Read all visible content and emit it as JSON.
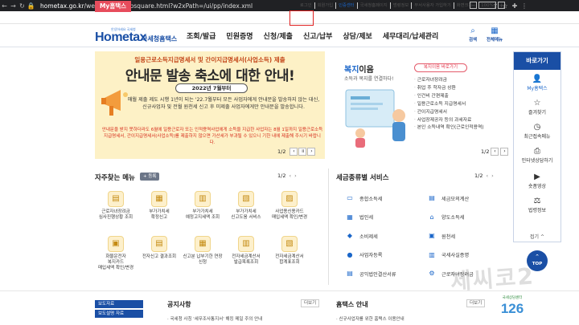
{
  "browser": {
    "url_host": "hometax.go.kr",
    "url_path": "/websquare/websquare.html?w2xPath=/ui/pp/index.xml"
  },
  "util_bar": {
    "my_hometax": "My홈택스",
    "links": [
      {
        "label": "로그인",
        "accent": false
      },
      {
        "label": "회원가입",
        "accent": false
      },
      {
        "label": "인증센터",
        "accent": true
      },
      {
        "label": "국세청홈페이지",
        "accent": false
      },
      {
        "label": "범령정보",
        "accent": false
      },
      {
        "label": "부서사용자 가입하기",
        "accent": false
      },
      {
        "label": "화면크기",
        "accent": false
      }
    ],
    "zoom_value": "100%"
  },
  "header": {
    "logo_main": "Hometax",
    "logo_sub": "국세청홈택스",
    "logo_tiny": "안녕하세요 국세청",
    "nav": [
      "조회/발급",
      "민원증명",
      "신청/제출",
      "신고/납부",
      "상담/제보",
      "세무대리/납세관리"
    ],
    "search_label": "검색",
    "allmenu_label": "전체메뉴"
  },
  "banner": {
    "title_small": "일용근로소득지급명세서 및 간이지급명세서(사업소득) 제출",
    "title_big": "안내문 발송 축소에 대한 안내!",
    "date": "2022년 7월부터",
    "body": "매월 제출 제도 시행 1년이 되는 '22.7월부터 모든 사업자에게 안내문을 발송하지 않는 대신, 신규사업자 및 전월 원천세 신고 후 미제출 사업자에게만 안내문을 발송합니다.",
    "notice": "안내문을 받지 못하더라도 6월에 일용근로자 또는 인적용역사업에게 소득을 지급한 사업자는 8월 1일까지 일용근로소득지급명세서, 간이지급명세서(사업소득)를 제출하지 않으면 가산세가 부과될 수 있으니 기한 내에 제출해 주시기 바랍니다.",
    "page": "1/2"
  },
  "welfare": {
    "title_a": "복지",
    "title_b": "이음",
    "desc": "소득과 복지를 연결하다!",
    "button": "복지이음 바로가기",
    "items": [
      "근로자녀장려금",
      "취업 후 학자금 상환",
      "인건비 간편제출",
      "일용근로소득 지급명세서",
      "간이지급명세서",
      "사업장제공자 등의 과세자료",
      "본인 소득내역 확인(근로인적용역)"
    ],
    "page": "1/2"
  },
  "sidebar": {
    "title": "바로가기",
    "items": [
      {
        "icon": "user-icon",
        "glyph": "👤",
        "label": "My홈택스"
      },
      {
        "icon": "star-icon",
        "glyph": "☆",
        "label": "즐겨찾기"
      },
      {
        "icon": "clock-icon",
        "glyph": "◷",
        "label": "최근접속메뉴"
      },
      {
        "icon": "printer-icon",
        "glyph": "⎙",
        "label": "인터넷상담하기"
      },
      {
        "icon": "video-icon",
        "glyph": "▶",
        "label": "숏폼영상"
      },
      {
        "icon": "scale-icon",
        "glyph": "⚖",
        "label": "법령정보"
      }
    ],
    "fold": "접기 ^",
    "top": "TOP"
  },
  "faq": {
    "title": "자주찾는 메뉴",
    "badge": "+ 등록",
    "page": "1/2",
    "items": [
      {
        "glyph": "▤",
        "label": "근로자녀장려금\n심사진행상황 조회"
      },
      {
        "glyph": "▦",
        "label": "부가가치세\n확정신고"
      },
      {
        "glyph": "▥",
        "label": "부가가치세\n예정고지세액 조회"
      },
      {
        "glyph": "▧",
        "label": "부가가치세\n신고도움 서비스"
      },
      {
        "glyph": "▨",
        "label": "사업용신용카드\n매입세액 확인/변경"
      },
      {
        "glyph": "▣",
        "label": "화물운전자\n복지카드\n매입세액 확인/변경"
      },
      {
        "glyph": "▤",
        "label": "전자신고 결과조회"
      },
      {
        "glyph": "▦",
        "label": "신고분 납부기한 연장신청"
      },
      {
        "glyph": "▥",
        "label": "전자세금계산서\n발급목록조회"
      },
      {
        "glyph": "▧",
        "label": "전자세금계산서\n합계표조회"
      }
    ]
  },
  "tax": {
    "title": "세금종류별 서비스",
    "page": "1/2",
    "items": [
      {
        "glyph": "▭",
        "label": "종합소득세"
      },
      {
        "glyph": "▤",
        "label": "세금모의계산"
      },
      {
        "glyph": "▦",
        "label": "법인세"
      },
      {
        "glyph": "⌂",
        "label": "양도소득세"
      },
      {
        "glyph": "◆",
        "label": "소비제세"
      },
      {
        "glyph": "▣",
        "label": "원천세"
      },
      {
        "glyph": "●",
        "label": "사업자등록"
      },
      {
        "glyph": "▥",
        "label": "국세사실증명"
      },
      {
        "glyph": "▤",
        "label": "공익법인결산서류"
      },
      {
        "glyph": "⚙",
        "label": "근로자녀장려금"
      }
    ]
  },
  "bottom": {
    "boxlist": [
      "보도자료",
      "보도설명 자료"
    ],
    "notice_title": "공지사항",
    "notice_more": "더보기",
    "notice_item": "· 국세청 사칭 '세무조사통지서' 해킹 메일 주의 안내",
    "home_title": "홈택스 안내",
    "home_more": "더보기",
    "home_item": "· 신규사업자를 위한 홈택스 이용안내",
    "num_small": "국세상담센터",
    "num_big": "126"
  },
  "watermark": "제씨코2",
  "colors": {
    "brand_blue": "#1a4fa5",
    "accent_red": "#e74c5c",
    "banner_bg": "#fdf1c6"
  }
}
